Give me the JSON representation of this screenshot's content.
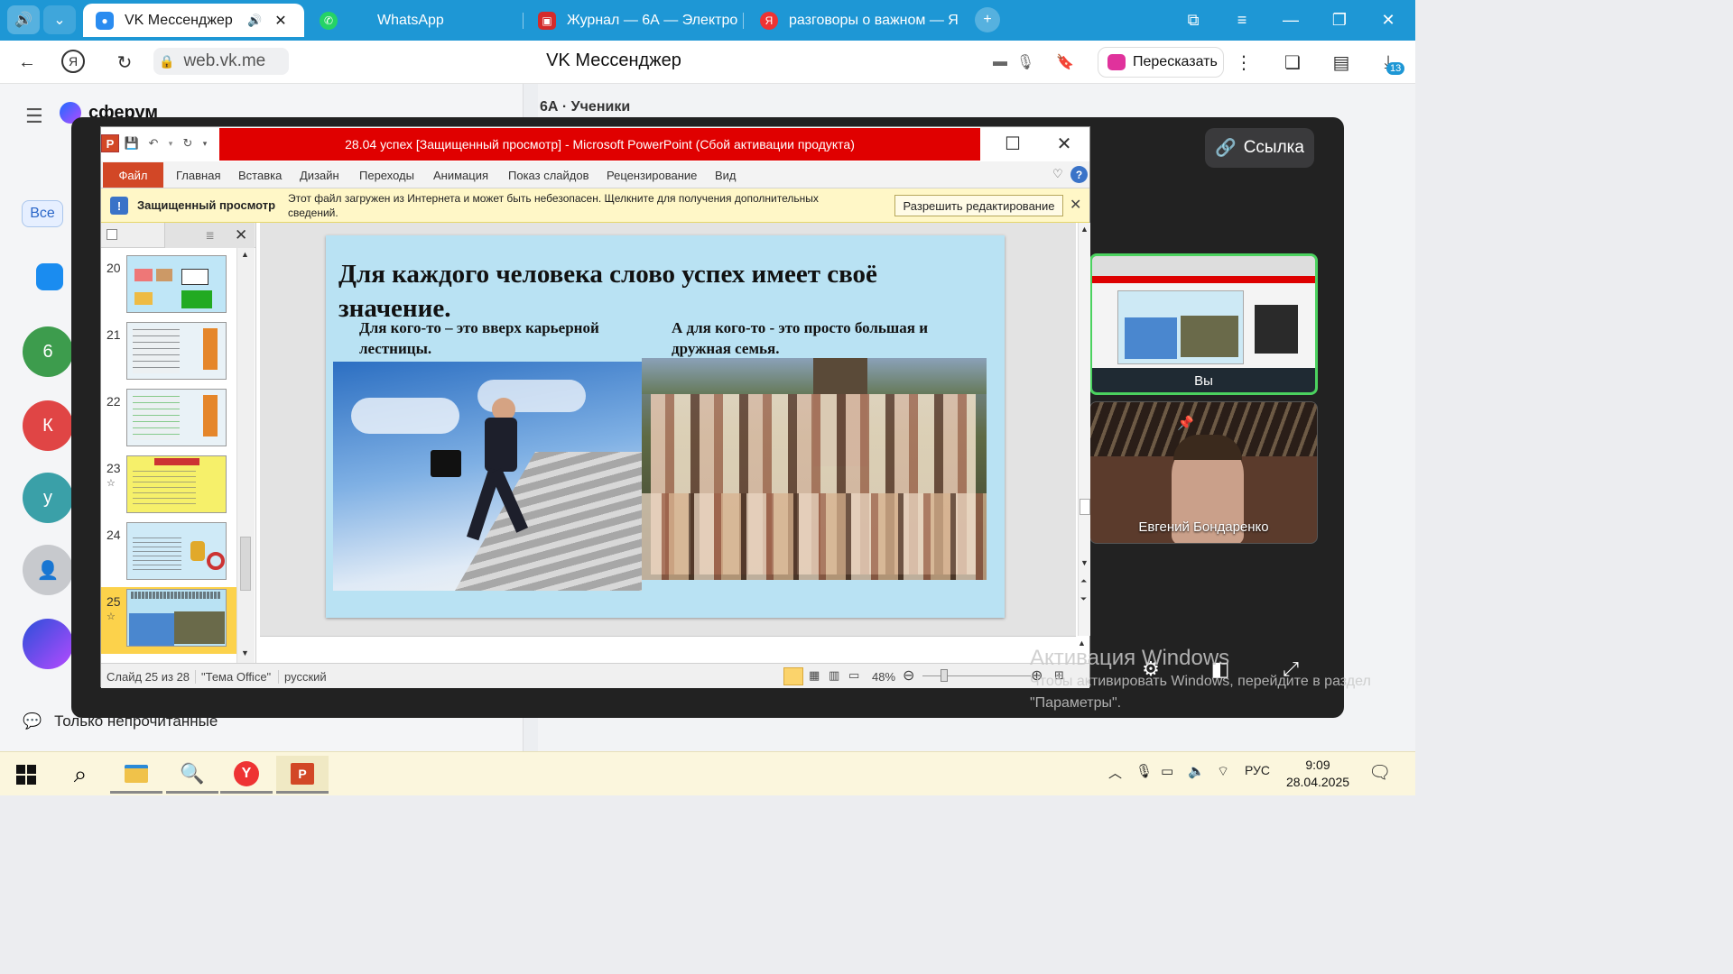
{
  "browser": {
    "tabs": [
      {
        "label": "VK Мессенджер",
        "active": true
      },
      {
        "label": "WhatsApp",
        "active": false
      },
      {
        "label": "Журнал — 6А — Электро",
        "active": false
      },
      {
        "label": "разговоры о важном — Я",
        "active": false
      }
    ],
    "url": "web.vk.me",
    "page_title": "VK Мессенджер",
    "retell_label": "Пересказать",
    "downloads_badge": "13"
  },
  "vk": {
    "brand": "сферум",
    "chat_title": "6А · Ученики",
    "filter_all": "Все",
    "only_unread": "Только непрочитанные",
    "link_button": "Ссылка",
    "avatars": [
      {
        "letter": "6",
        "color": "#3d9c4d"
      },
      {
        "letter": "К",
        "color": "#e04545"
      },
      {
        "letter": "у",
        "color": "#3aa0a8"
      }
    ]
  },
  "participants": [
    {
      "name": "Вы"
    },
    {
      "name": "Евгений Бондаренко"
    }
  ],
  "ppt": {
    "title": "28.04 успех [Защищенный просмотр] - Microsoft PowerPoint (Сбой активации продукта)",
    "file_tab": "Файл",
    "ribbon_tabs": [
      "Главная",
      "Вставка",
      "Дизайн",
      "Переходы",
      "Анимация",
      "Показ слайдов",
      "Рецензирование",
      "Вид"
    ],
    "protected_title": "Защищенный просмотр",
    "protected_message": "Этот файл загружен из Интернета и может быть небезопасен. Щелкните для получения дополнительных сведений.",
    "enable_editing": "Разрешить редактирование",
    "thumbnails": [
      {
        "num": "20",
        "star": false,
        "selected": false
      },
      {
        "num": "21",
        "star": false,
        "selected": false
      },
      {
        "num": "22",
        "star": false,
        "selected": false
      },
      {
        "num": "23",
        "star": true,
        "selected": false
      },
      {
        "num": "24",
        "star": false,
        "selected": false
      },
      {
        "num": "25",
        "star": true,
        "selected": true
      }
    ],
    "slide": {
      "title": "Для каждого человека слово успех имеет своё значение.",
      "left_caption": "Для кого-то – это вверх карьерной лестницы.",
      "right_caption": "А для кого-то -  это просто большая и дружная семья."
    },
    "status": {
      "slide_counter": "Слайд 25 из 28",
      "theme": "\"Тема Office\"",
      "language": "русский",
      "zoom": "48%"
    }
  },
  "activation": {
    "line1": "Активация Windows",
    "line2": "Чтобы активировать Windows, перейдите в раздел \"Параметры\"."
  },
  "taskbar": {
    "lang": "РУС",
    "time": "9:09",
    "date": "28.04.2025"
  },
  "colors": {
    "browser_accent": "#1e97d5",
    "ppt_title_alert": "#e00000",
    "ppt_file_tab": "#d24726",
    "active_speaker": "#4bd25f"
  }
}
